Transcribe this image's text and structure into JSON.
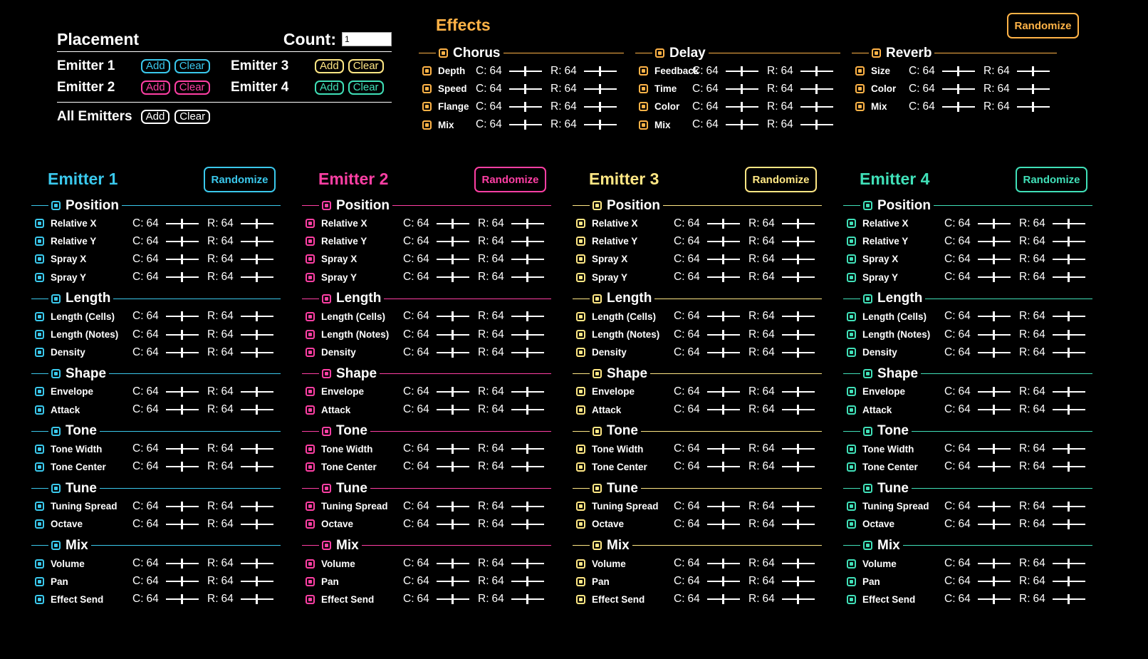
{
  "colors": {
    "emitter1": "#3ac8ec",
    "emitter2": "#ff3fa4",
    "emitter3": "#ffe784",
    "emitter4": "#40e0b8",
    "effects": "#ffb347",
    "white": "#ffffff"
  },
  "placement": {
    "title": "Placement",
    "count_label": "Count:",
    "count_value": "1",
    "add_label": "Add",
    "clear_label": "Clear",
    "emitters": [
      "Emitter 1",
      "Emitter 2",
      "Emitter 3",
      "Emitter 4"
    ],
    "all_label": "All Emitters"
  },
  "effects": {
    "title": "Effects",
    "randomize_label": "Randomize",
    "groups": [
      {
        "name": "Chorus",
        "params": [
          "Depth",
          "Speed",
          "Flange",
          "Mix"
        ]
      },
      {
        "name": "Delay",
        "params": [
          "Feedback",
          "Time",
          "Color",
          "Mix"
        ]
      },
      {
        "name": "Reverb",
        "params": [
          "Size",
          "Color",
          "Mix"
        ]
      }
    ]
  },
  "param_value": {
    "c_label": "C:",
    "c": "64",
    "r_label": "R:",
    "r": "64",
    "c_slider": 0.5,
    "r_slider": 0.5
  },
  "emitters": [
    {
      "title": "Emitter 1",
      "randomize_label": "Randomize",
      "color_key": "emitter1"
    },
    {
      "title": "Emitter 2",
      "randomize_label": "Randomize",
      "color_key": "emitter2"
    },
    {
      "title": "Emitter 3",
      "randomize_label": "Randomize",
      "color_key": "emitter3"
    },
    {
      "title": "Emitter 4",
      "randomize_label": "Randomize",
      "color_key": "emitter4"
    }
  ],
  "emitter_sections": [
    {
      "name": "Position",
      "params": [
        "Relative X",
        "Relative Y",
        "Spray X",
        "Spray Y"
      ]
    },
    {
      "name": "Length",
      "params": [
        "Length (Cells)",
        "Length (Notes)",
        "Density"
      ]
    },
    {
      "name": "Shape",
      "params": [
        "Envelope",
        "Attack"
      ]
    },
    {
      "name": "Tone",
      "params": [
        "Tone Width",
        "Tone Center"
      ]
    },
    {
      "name": "Tune",
      "params": [
        "Tuning Spread",
        "Octave"
      ]
    },
    {
      "name": "Mix",
      "params": [
        "Volume",
        "Pan",
        "Effect Send"
      ]
    }
  ]
}
